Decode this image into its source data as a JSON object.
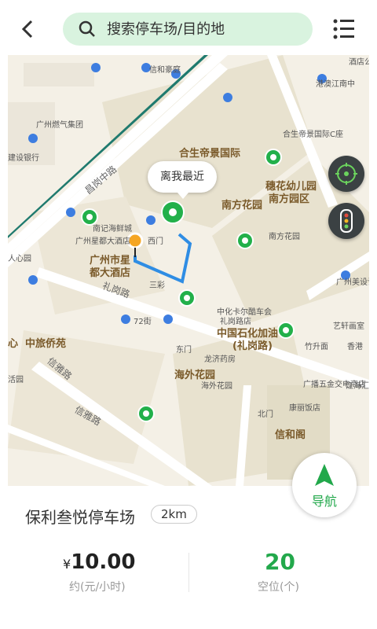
{
  "header": {
    "search_placeholder": "搜索停车场/目的地",
    "back_icon": "back-arrow-icon",
    "menu_icon": "list-menu-icon"
  },
  "map": {
    "callout": "离我最近",
    "roads": [
      "昌岗中路",
      "礼岗路",
      "信雅路",
      "信雅路"
    ],
    "places": [
      "合生帝景国际",
      "穗花幼儿园",
      "南方园区",
      "南方花园",
      "广州市星",
      "都大酒店",
      "中国石化加油",
      "(礼岗路)",
      "海外花园",
      "中旅侨苑",
      "信和阁",
      "心"
    ],
    "minor_labels": [
      "信和豪庭",
      "广州燃气集团",
      "建设银行",
      "南记海鲜城",
      "广州星都大酒店",
      "西门",
      "三彩",
      "72街",
      "中化卡尔酷车会",
      "礼岗路店",
      "龙济药房",
      "海外花园",
      "东门",
      "北门",
      "康丽饭店",
      "竹升面",
      "艺轩画室",
      "香港",
      "广播五金交电商店",
      "江海汇金",
      "南方花园",
      "合生帝景国际C座",
      "港澳江南中",
      "酒店公",
      "广州美设计有限",
      "活园",
      "人心园"
    ]
  },
  "controls": {
    "locate_icon": "locate-target-icon",
    "traffic_icon": "traffic-light-icon"
  },
  "nav_button": {
    "label": "导航",
    "icon": "navigation-arrow-icon"
  },
  "parking": {
    "name": "保利叁悦停车场",
    "distance": "2km",
    "price_symbol": "¥",
    "price": "10.00",
    "price_caption": "约(元/小时)",
    "spots": "20",
    "spots_caption": "空位(个)"
  },
  "colors": {
    "accent": "#22a84b",
    "search_bg": "#d9f3df",
    "rail": "#1f7a6e"
  }
}
